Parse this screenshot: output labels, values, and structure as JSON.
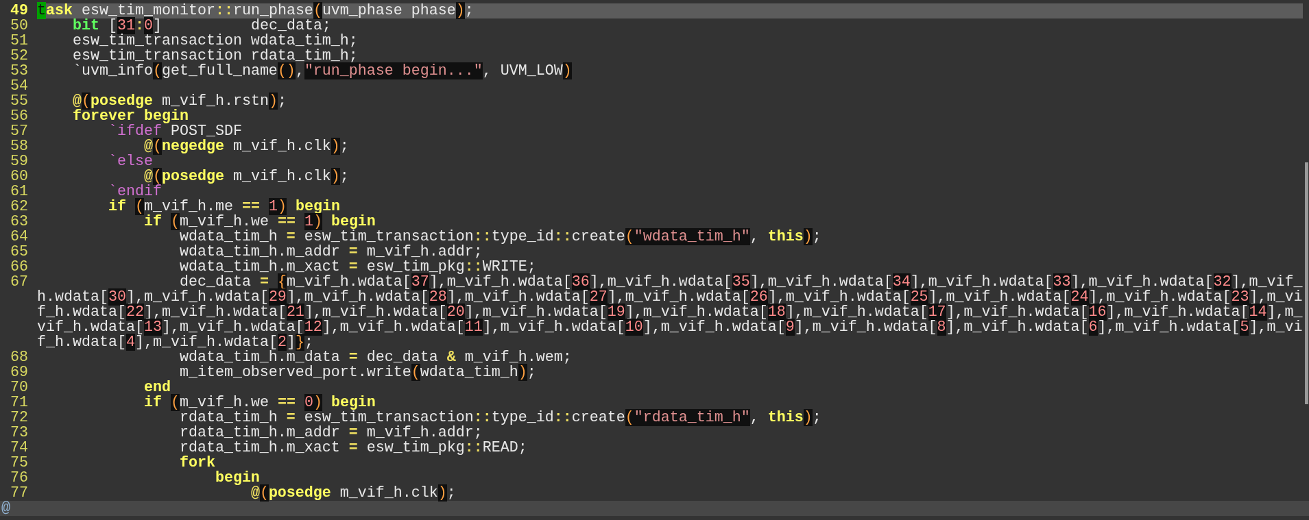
{
  "lines": [
    {
      "number": "49",
      "current": true,
      "tokens": [
        {
          "kind": "cursor",
          "text": "t"
        },
        {
          "kind": "keyword",
          "text": "ask"
        },
        {
          "kind": "plain",
          "text": " esw_tim_monitor"
        },
        {
          "kind": "operator",
          "text": "::"
        },
        {
          "kind": "plain",
          "text": "run_phase"
        },
        {
          "kind": "paren",
          "text": "("
        },
        {
          "kind": "plain",
          "text": "uvm_phase phase"
        },
        {
          "kind": "paren",
          "text": ")"
        },
        {
          "kind": "plain",
          "text": ";"
        }
      ]
    },
    {
      "number": "50",
      "current": false,
      "tokens": [
        {
          "kind": "type",
          "text": "    bit"
        },
        {
          "kind": "plain",
          "text": " ["
        },
        {
          "kind": "number",
          "text": "31"
        },
        {
          "kind": "operator",
          "text": ":"
        },
        {
          "kind": "number",
          "text": "0"
        },
        {
          "kind": "plain",
          "text": "]          dec_data;"
        }
      ]
    },
    {
      "number": "51",
      "current": false,
      "tokens": [
        {
          "kind": "plain",
          "text": "    esw_tim_transaction wdata_tim_h;"
        }
      ]
    },
    {
      "number": "52",
      "current": false,
      "tokens": [
        {
          "kind": "plain",
          "text": "    esw_tim_transaction rdata_tim_h;"
        }
      ]
    },
    {
      "number": "53",
      "current": false,
      "tokens": [
        {
          "kind": "plain",
          "text": "    `uvm_info"
        },
        {
          "kind": "paren",
          "text": "("
        },
        {
          "kind": "plain",
          "text": "get_full_name"
        },
        {
          "kind": "paren",
          "text": "()"
        },
        {
          "kind": "plain",
          "text": ","
        },
        {
          "kind": "string",
          "text": "\"run_phase begin...\""
        },
        {
          "kind": "plain",
          "text": ", UVM_LOW"
        },
        {
          "kind": "paren",
          "text": ")"
        }
      ]
    },
    {
      "number": "54",
      "current": false
    },
    {
      "number": "55",
      "current": false,
      "tokens": [
        {
          "kind": "operator",
          "text": "    @"
        },
        {
          "kind": "paren",
          "text": "("
        },
        {
          "kind": "keyword",
          "text": "posedge"
        },
        {
          "kind": "plain",
          "text": " m_vif_h.rstn"
        },
        {
          "kind": "paren",
          "text": ")"
        },
        {
          "kind": "plain",
          "text": ";"
        }
      ]
    },
    {
      "number": "56",
      "current": false,
      "tokens": [
        {
          "kind": "keyword",
          "text": "    forever begin"
        }
      ]
    },
    {
      "number": "57",
      "current": false,
      "tokens": [
        {
          "kind": "preproc",
          "text": "        `ifdef"
        },
        {
          "kind": "plain",
          "text": " POST_SDF"
        }
      ]
    },
    {
      "number": "58",
      "current": false,
      "tokens": [
        {
          "kind": "operator",
          "text": "            @"
        },
        {
          "kind": "paren",
          "text": "("
        },
        {
          "kind": "keyword",
          "text": "negedge"
        },
        {
          "kind": "plain",
          "text": " m_vif_h.clk"
        },
        {
          "kind": "paren",
          "text": ")"
        },
        {
          "kind": "plain",
          "text": ";"
        }
      ]
    },
    {
      "number": "59",
      "current": false,
      "tokens": [
        {
          "kind": "preproc",
          "text": "        `else"
        }
      ]
    },
    {
      "number": "60",
      "current": false,
      "tokens": [
        {
          "kind": "operator",
          "text": "            @"
        },
        {
          "kind": "paren",
          "text": "("
        },
        {
          "kind": "keyword",
          "text": "posedge"
        },
        {
          "kind": "plain",
          "text": " m_vif_h.clk"
        },
        {
          "kind": "paren",
          "text": ")"
        },
        {
          "kind": "plain",
          "text": ";"
        }
      ]
    },
    {
      "number": "61",
      "current": false,
      "tokens": [
        {
          "kind": "preproc",
          "text": "        `endif"
        }
      ]
    },
    {
      "number": "62",
      "current": false,
      "tokens": [
        {
          "kind": "keyword",
          "text": "        if "
        },
        {
          "kind": "paren",
          "text": "("
        },
        {
          "kind": "plain",
          "text": "m_vif_h.me "
        },
        {
          "kind": "operator",
          "text": "== "
        },
        {
          "kind": "number",
          "text": "1"
        },
        {
          "kind": "paren",
          "text": ")"
        },
        {
          "kind": "keyword",
          "text": " begin"
        }
      ]
    },
    {
      "number": "63",
      "current": false,
      "tokens": [
        {
          "kind": "keyword",
          "text": "            if "
        },
        {
          "kind": "paren",
          "text": "("
        },
        {
          "kind": "plain",
          "text": "m_vif_h.we "
        },
        {
          "kind": "operator",
          "text": "== "
        },
        {
          "kind": "number",
          "text": "1"
        },
        {
          "kind": "paren",
          "text": ")"
        },
        {
          "kind": "keyword",
          "text": " begin"
        }
      ]
    },
    {
      "number": "64",
      "current": false,
      "tokens": [
        {
          "kind": "plain",
          "text": "                wdata_tim_h "
        },
        {
          "kind": "operator",
          "text": "="
        },
        {
          "kind": "plain",
          "text": " esw_tim_transaction"
        },
        {
          "kind": "operator",
          "text": "::"
        },
        {
          "kind": "plain",
          "text": "type_id"
        },
        {
          "kind": "operator",
          "text": "::"
        },
        {
          "kind": "plain",
          "text": "create"
        },
        {
          "kind": "paren",
          "text": "("
        },
        {
          "kind": "string",
          "text": "\"wdata_tim_h\""
        },
        {
          "kind": "plain",
          "text": ", "
        },
        {
          "kind": "keyword",
          "text": "this"
        },
        {
          "kind": "paren",
          "text": ")"
        },
        {
          "kind": "plain",
          "text": ";"
        }
      ]
    },
    {
      "number": "65",
      "current": false,
      "tokens": [
        {
          "kind": "plain",
          "text": "                wdata_tim_h.m_addr "
        },
        {
          "kind": "operator",
          "text": "="
        },
        {
          "kind": "plain",
          "text": " m_vif_h.addr;"
        }
      ]
    },
    {
      "number": "66",
      "current": false,
      "tokens": [
        {
          "kind": "plain",
          "text": "                wdata_tim_h.m_xact "
        },
        {
          "kind": "operator",
          "text": "="
        },
        {
          "kind": "plain",
          "text": " esw_tim_pkg"
        },
        {
          "kind": "operator",
          "text": "::"
        },
        {
          "kind": "plain",
          "text": "WRITE;"
        }
      ]
    },
    {
      "number": "67",
      "current": false,
      "tokens": [
        {
          "kind": "plain",
          "text": "                dec_data "
        },
        {
          "kind": "operator",
          "text": "= "
        },
        {
          "kind": "paren",
          "text": "{"
        },
        {
          "kind": "plain",
          "text": "m_vif_h.wdata["
        },
        {
          "kind": "number",
          "text": "37"
        },
        {
          "kind": "plain",
          "text": "],m_vif_h.wdata["
        },
        {
          "kind": "number",
          "text": "36"
        },
        {
          "kind": "plain",
          "text": "],m_vif_h.wdata["
        },
        {
          "kind": "number",
          "text": "35"
        },
        {
          "kind": "plain",
          "text": "],m_vif_h.wdata["
        },
        {
          "kind": "number",
          "text": "34"
        },
        {
          "kind": "plain",
          "text": "],m_vif_h.wdata["
        },
        {
          "kind": "number",
          "text": "33"
        },
        {
          "kind": "plain",
          "text": "],m_vif_h.wdata["
        },
        {
          "kind": "number",
          "text": "32"
        },
        {
          "kind": "plain",
          "text": "],m_vif_h.wdata["
        },
        {
          "kind": "number",
          "text": "30"
        },
        {
          "kind": "plain",
          "text": "],m_vif_h.wdata["
        },
        {
          "kind": "number",
          "text": "29"
        },
        {
          "kind": "plain",
          "text": "],m_vif_h.wdata["
        },
        {
          "kind": "number",
          "text": "28"
        },
        {
          "kind": "plain",
          "text": "],m_vif_h.wdata["
        },
        {
          "kind": "number",
          "text": "27"
        },
        {
          "kind": "plain",
          "text": "],m_vif_h.wdata["
        },
        {
          "kind": "number",
          "text": "26"
        },
        {
          "kind": "plain",
          "text": "],m_vif_h.wdata["
        },
        {
          "kind": "number",
          "text": "25"
        },
        {
          "kind": "plain",
          "text": "],m_vif_h.wdata["
        },
        {
          "kind": "number",
          "text": "24"
        },
        {
          "kind": "plain",
          "text": "],m_vif_h.wdata["
        },
        {
          "kind": "number",
          "text": "23"
        },
        {
          "kind": "plain",
          "text": "],m_vif_h.wdata["
        },
        {
          "kind": "number",
          "text": "22"
        },
        {
          "kind": "plain",
          "text": "],m_vif_h.wdata["
        },
        {
          "kind": "number",
          "text": "21"
        },
        {
          "kind": "plain",
          "text": "],m_vif_h.wdata["
        },
        {
          "kind": "number",
          "text": "20"
        },
        {
          "kind": "plain",
          "text": "],m_vif_h.wdata["
        },
        {
          "kind": "number",
          "text": "19"
        },
        {
          "kind": "plain",
          "text": "],m_vif_h.wdata["
        },
        {
          "kind": "number",
          "text": "18"
        },
        {
          "kind": "plain",
          "text": "],m_vif_h.wdata["
        },
        {
          "kind": "number",
          "text": "17"
        },
        {
          "kind": "plain",
          "text": "],m_vif_h.wdata["
        },
        {
          "kind": "number",
          "text": "16"
        },
        {
          "kind": "plain",
          "text": "],m_vif_h.wdata["
        },
        {
          "kind": "number",
          "text": "14"
        },
        {
          "kind": "plain",
          "text": "],m_vif_h.wdata["
        },
        {
          "kind": "number",
          "text": "13"
        },
        {
          "kind": "plain",
          "text": "],m_vif_h.wdata["
        },
        {
          "kind": "number",
          "text": "12"
        },
        {
          "kind": "plain",
          "text": "],m_vif_h.wdata["
        },
        {
          "kind": "number",
          "text": "11"
        },
        {
          "kind": "plain",
          "text": "],m_vif_h.wdata["
        },
        {
          "kind": "number",
          "text": "10"
        },
        {
          "kind": "plain",
          "text": "],m_vif_h.wdata["
        },
        {
          "kind": "number",
          "text": "9"
        },
        {
          "kind": "plain",
          "text": "],m_vif_h.wdata["
        },
        {
          "kind": "number",
          "text": "8"
        },
        {
          "kind": "plain",
          "text": "],m_vif_h.wdata["
        },
        {
          "kind": "number",
          "text": "6"
        },
        {
          "kind": "plain",
          "text": "],m_vif_h.wdata["
        },
        {
          "kind": "number",
          "text": "5"
        },
        {
          "kind": "plain",
          "text": "],m_vif_h.wdata["
        },
        {
          "kind": "number",
          "text": "4"
        },
        {
          "kind": "plain",
          "text": "],m_vif_h.wdata["
        },
        {
          "kind": "number",
          "text": "2"
        },
        {
          "kind": "plain",
          "text": "]"
        },
        {
          "kind": "paren",
          "text": "}"
        },
        {
          "kind": "plain",
          "text": ";"
        }
      ]
    },
    {
      "number": "68",
      "current": false,
      "tokens": [
        {
          "kind": "plain",
          "text": "                wdata_tim_h.m_data "
        },
        {
          "kind": "operator",
          "text": "="
        },
        {
          "kind": "plain",
          "text": " dec_data "
        },
        {
          "kind": "operator",
          "text": "&"
        },
        {
          "kind": "plain",
          "text": " m_vif_h.wem;"
        }
      ]
    },
    {
      "number": "69",
      "current": false,
      "tokens": [
        {
          "kind": "plain",
          "text": "                m_item_observed_port.write"
        },
        {
          "kind": "paren",
          "text": "("
        },
        {
          "kind": "plain",
          "text": "wdata_tim_h"
        },
        {
          "kind": "paren",
          "text": ")"
        },
        {
          "kind": "plain",
          "text": ";"
        }
      ]
    },
    {
      "number": "70",
      "current": false,
      "tokens": [
        {
          "kind": "keyword",
          "text": "            end"
        }
      ]
    },
    {
      "number": "71",
      "current": false,
      "tokens": [
        {
          "kind": "keyword",
          "text": "            if "
        },
        {
          "kind": "paren",
          "text": "("
        },
        {
          "kind": "plain",
          "text": "m_vif_h.we "
        },
        {
          "kind": "operator",
          "text": "== "
        },
        {
          "kind": "number",
          "text": "0"
        },
        {
          "kind": "paren",
          "text": ")"
        },
        {
          "kind": "keyword",
          "text": " begin"
        }
      ]
    },
    {
      "number": "72",
      "current": false,
      "tokens": [
        {
          "kind": "plain",
          "text": "                rdata_tim_h "
        },
        {
          "kind": "operator",
          "text": "="
        },
        {
          "kind": "plain",
          "text": " esw_tim_transaction"
        },
        {
          "kind": "operator",
          "text": "::"
        },
        {
          "kind": "plain",
          "text": "type_id"
        },
        {
          "kind": "operator",
          "text": "::"
        },
        {
          "kind": "plain",
          "text": "create"
        },
        {
          "kind": "paren",
          "text": "("
        },
        {
          "kind": "string",
          "text": "\"rdata_tim_h\""
        },
        {
          "kind": "plain",
          "text": ", "
        },
        {
          "kind": "keyword",
          "text": "this"
        },
        {
          "kind": "paren",
          "text": ")"
        },
        {
          "kind": "plain",
          "text": ";"
        }
      ]
    },
    {
      "number": "73",
      "current": false,
      "tokens": [
        {
          "kind": "plain",
          "text": "                rdata_tim_h.m_addr "
        },
        {
          "kind": "operator",
          "text": "="
        },
        {
          "kind": "plain",
          "text": " m_vif_h.addr;"
        }
      ]
    },
    {
      "number": "74",
      "current": false,
      "tokens": [
        {
          "kind": "plain",
          "text": "                rdata_tim_h.m_xact "
        },
        {
          "kind": "operator",
          "text": "="
        },
        {
          "kind": "plain",
          "text": " esw_tim_pkg"
        },
        {
          "kind": "operator",
          "text": "::"
        },
        {
          "kind": "plain",
          "text": "READ;"
        }
      ]
    },
    {
      "number": "75",
      "current": false,
      "tokens": [
        {
          "kind": "keyword",
          "text": "                fork"
        }
      ]
    },
    {
      "number": "76",
      "current": false,
      "tokens": [
        {
          "kind": "keyword",
          "text": "                    begin"
        }
      ]
    },
    {
      "number": "77",
      "current": false,
      "tokens": [
        {
          "kind": "operator",
          "text": "                        @"
        },
        {
          "kind": "paren",
          "text": "("
        },
        {
          "kind": "keyword",
          "text": "posedge"
        },
        {
          "kind": "plain",
          "text": " m_vif_h.clk"
        },
        {
          "kind": "paren",
          "text": ")"
        },
        {
          "kind": "plain",
          "text": ";"
        }
      ]
    }
  ],
  "overflow_marker": "@"
}
